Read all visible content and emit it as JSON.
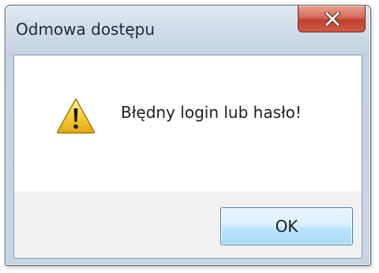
{
  "window": {
    "title": "Odmowa dostępu",
    "close_icon": "close-x-icon"
  },
  "dialog": {
    "icon": "warning-icon",
    "message": "Błędny login lub hasło!",
    "ok_label": "OK"
  },
  "colors": {
    "close_button": "#c7503c",
    "ok_button_border": "#3c7fb1",
    "warning_yellow": "#f7d03a"
  }
}
